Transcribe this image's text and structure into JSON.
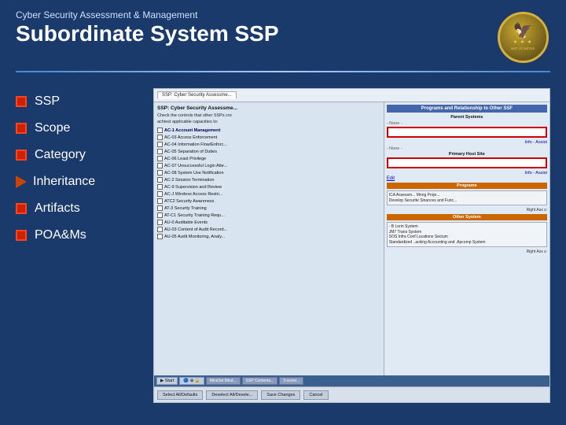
{
  "header": {
    "subtitle": "Cyber Security Assessment & Management",
    "title": "Subordinate System SSP"
  },
  "nav": {
    "items": [
      {
        "id": "ssp",
        "label": "SSP",
        "type": "bullet"
      },
      {
        "id": "scope",
        "label": "Scope",
        "type": "bullet"
      },
      {
        "id": "category",
        "label": "Category",
        "type": "bullet"
      },
      {
        "id": "inheritance",
        "label": "Inheritance",
        "type": "arrow"
      },
      {
        "id": "artifacts",
        "label": "Artifacts",
        "type": "bullet"
      },
      {
        "id": "poa-ms",
        "label": "POA&Ms",
        "type": "bullet"
      }
    ]
  },
  "screenshot": {
    "top_tab": "SSP: Cyber Security Assessme...",
    "right_tab1": "Programs and Relationship to Other SSF",
    "right_tab_sub": "Parent Systems",
    "primary_label": "Primary Host Site",
    "none_label": "- None -",
    "prog_label": "Programs",
    "other_label": "Other System",
    "edit_link": "Edit",
    "info_assist": "Info - Assist",
    "right_assist1": "Right Ass s:",
    "right_assist2": "Right Ass s:",
    "checkboxes": [
      {
        "id": "ac-1",
        "label": "AC-1  Account Management"
      },
      {
        "id": "ac-03",
        "label": "AC-03  Access Enforcement"
      },
      {
        "id": "ac-04",
        "label": "AC-04  Information Flow/Enforc..."
      },
      {
        "id": "ac-05",
        "label": "AC-05  Separation of Duties"
      },
      {
        "id": "ac-06",
        "label": "AC-06  Least Privilege"
      },
      {
        "id": "ac-07",
        "label": "AC-07  Unsuccessful Login Atte..."
      },
      {
        "id": "ac-08",
        "label": "AC-08  System Use Notification"
      },
      {
        "id": "ac-2",
        "label": "AC-2  Session Termination"
      },
      {
        "id": "ac-9",
        "label": "AC-9  Supervision and Review"
      },
      {
        "id": "ac-j",
        "label": "AC-J  Wireless Access Restri..."
      },
      {
        "id": "atc2",
        "label": "ATC2  Security Awareness"
      },
      {
        "id": "at-3",
        "label": "AT-3  Security Training"
      },
      {
        "id": "at-c1",
        "label": "AT-C1  Security Training Requ..."
      },
      {
        "id": "au-0",
        "label": "AU-0  Auditable Events"
      },
      {
        "id": "au-03",
        "label": "AU-03  Content of Audit Record..."
      },
      {
        "id": "au-05",
        "label": "AU-05  Audit Monitoring, Analy..."
      }
    ],
    "programs_text": "ICA Assessm... Mnng Proje...\nDevelop Securite Sinances and Func...",
    "other_systems_text": "- B Lerin System\nJM7 Trans System\nSOS Infra Conf Locations Sectum\nStandardized ..acking Accounting and .Apcomp System",
    "taskbar": {
      "start": "Start",
      "items": [
        "MindJet Mind...",
        "SSP Contenta...",
        "3-scree..."
      ]
    },
    "bottom_buttons": [
      "Select All/Defaults",
      "Deselect All/Desele...",
      "Save Changes",
      "Cancel"
    ]
  },
  "colors": {
    "background": "#1a3a6b",
    "accent": "#cc2200",
    "nav_text": "#ffffff",
    "divider": "#4488cc"
  }
}
